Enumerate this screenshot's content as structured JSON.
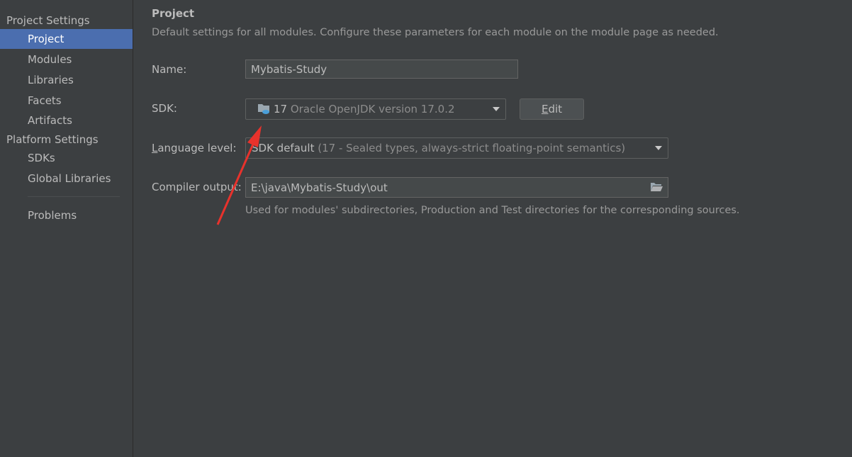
{
  "sidebar": {
    "project_settings_header": "Project Settings",
    "project_items": [
      {
        "label": "Project"
      },
      {
        "label": "Modules"
      },
      {
        "label": "Libraries"
      },
      {
        "label": "Facets"
      },
      {
        "label": "Artifacts"
      }
    ],
    "platform_settings_header": "Platform Settings",
    "platform_items": [
      {
        "label": "SDKs"
      },
      {
        "label": "Global Libraries"
      }
    ],
    "problems_label": "Problems"
  },
  "main": {
    "title": "Project",
    "description": "Default settings for all modules. Configure these parameters for each module on the module page as needed.",
    "name": {
      "label": "Name:",
      "value": "Mybatis-Study"
    },
    "sdk": {
      "label": "SDK:",
      "version": "17",
      "detail": "Oracle OpenJDK version 17.0.2",
      "edit_button_mnemonic": "E",
      "edit_button_rest": "dit"
    },
    "language_level": {
      "label_mnemonic": "L",
      "label_rest": "anguage level:",
      "value": "SDK default",
      "detail": "(17 - Sealed types, always-strict floating-point semantics)"
    },
    "compiler_output": {
      "label": "Compiler output:",
      "value": "E:\\java\\Mybatis-Study\\out",
      "hint": "Used for modules' subdirectories, Production and Test directories for the corresponding sources."
    }
  },
  "colors": {
    "background": "#3c3f41",
    "selection": "#4b6eaf",
    "annotation_arrow": "#e8322c",
    "sdk_icon": "#4a9fd9"
  },
  "icons": [
    "sdk-folder-icon",
    "dropdown-arrow-icon",
    "browse-folder-icon",
    "annotation-arrow"
  ]
}
